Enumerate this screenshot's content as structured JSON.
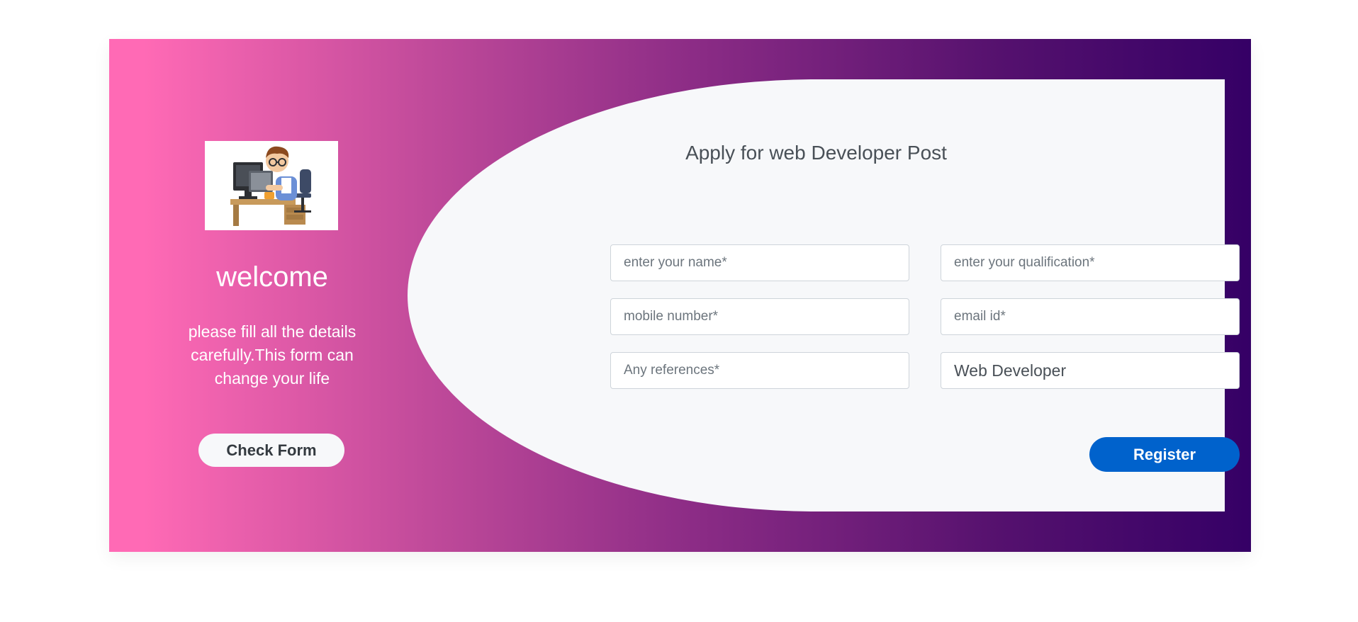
{
  "sidebar": {
    "logo_icon": "developer-at-computer-illustration",
    "welcome": "welcome",
    "description": "please fill all the details carefully.This form can change your life",
    "check_button": "Check Form"
  },
  "form": {
    "title": "Apply for web Developer Post",
    "fields": {
      "name": {
        "placeholder": "enter your name*",
        "value": ""
      },
      "qualification": {
        "placeholder": "enter your qualification*",
        "value": ""
      },
      "mobile": {
        "placeholder": "mobile number*",
        "value": ""
      },
      "email": {
        "placeholder": "email id*",
        "value": ""
      },
      "references": {
        "placeholder": "Any references*",
        "value": ""
      },
      "post": {
        "placeholder": "",
        "value": "Web Developer"
      }
    },
    "register_button": "Register"
  },
  "colors": {
    "gradient_start": "#ff6ab5",
    "gradient_end": "#350066",
    "panel_bg": "#f7f8fa",
    "primary_button": "#0062cc"
  }
}
